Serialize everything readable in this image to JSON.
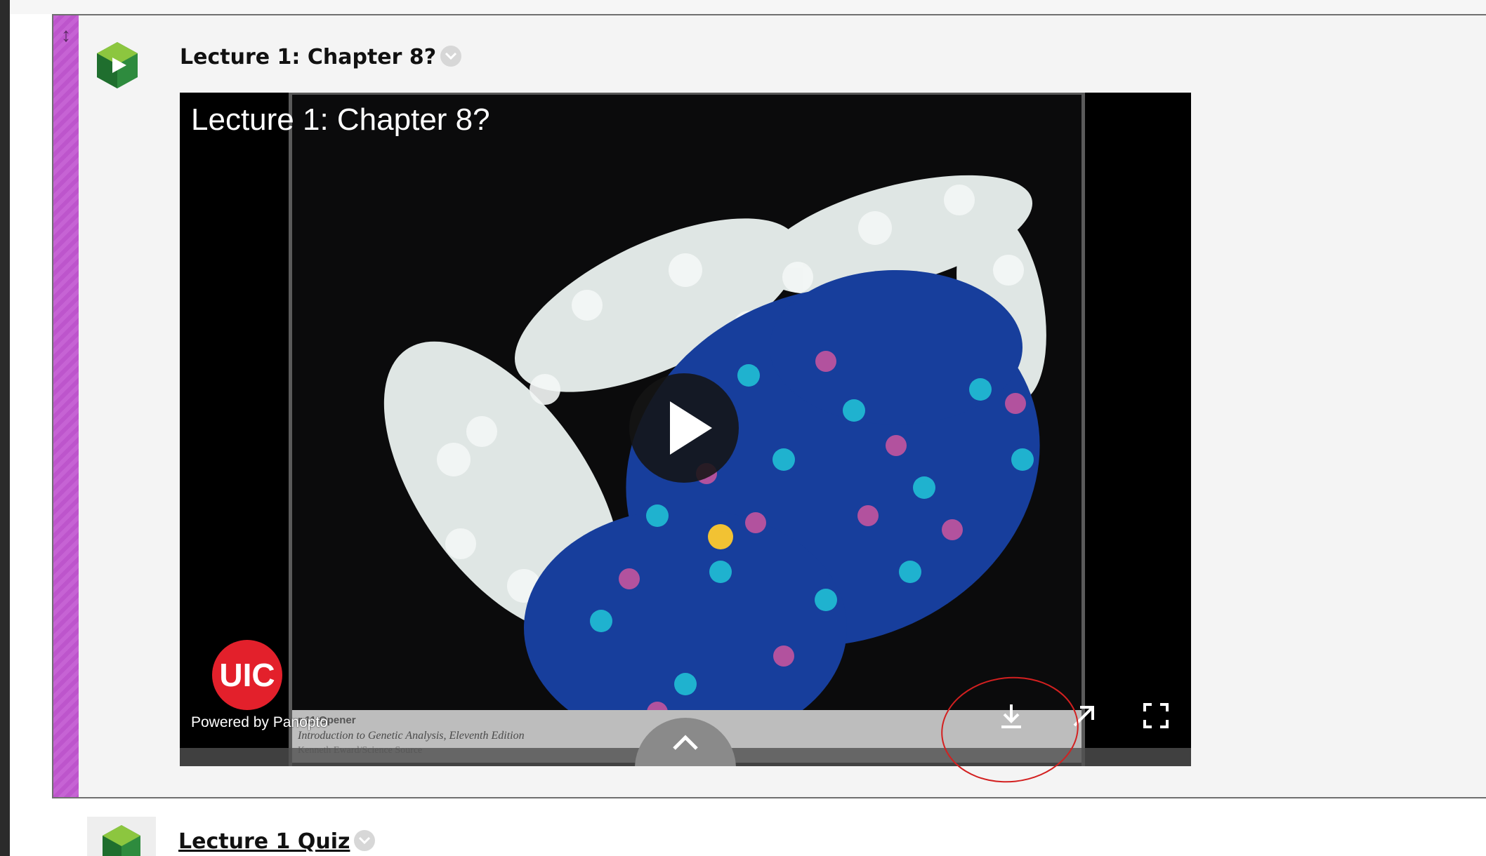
{
  "item": {
    "title": "Lecture 1: Chapter 8?",
    "options_icon": "chevron-down-icon"
  },
  "player": {
    "video_title": "Lecture 1: Chapter 8?",
    "powered_by": "Powered by Panopto",
    "logo_text": "UIC",
    "slide_caption": {
      "line1": "r 11 Opener",
      "line2": "Introduction to Genetic Analysis, Eleventh Edition",
      "line3": "Kenneth Eward/Science Source"
    },
    "controls": [
      "download-icon",
      "open-in-new-window-icon",
      "fullscreen-icon"
    ],
    "play_icon": "play-icon",
    "expand_icon": "chevron-up-icon"
  },
  "next_item": {
    "title": "Lecture 1 Quiz",
    "options_icon": "chevron-down-icon"
  },
  "colors": {
    "drag_bar": "#c663d4",
    "uic_red": "#e3202b",
    "annotation_red": "#d32020"
  }
}
